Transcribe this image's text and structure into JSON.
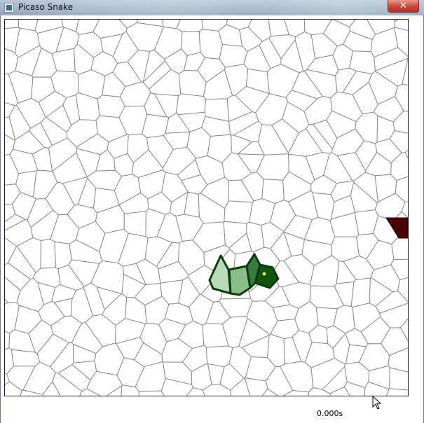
{
  "window": {
    "title": "Picaso Snake",
    "close_glyph": "✕"
  },
  "icons": {
    "app": "app-icon",
    "close": "close-icon",
    "cursor": "mouse-pointer-icon"
  },
  "status": {
    "timer": "0.000s"
  },
  "game": {
    "snake_length": 4,
    "colors": {
      "cell_border": "#8a8a8a",
      "snake_outline": "#0b3d0b",
      "snake_segments": [
        "#bcd9bc",
        "#8bbd8b",
        "#3a7a3a",
        "#0f540f"
      ],
      "head_dot": "#d9e86a",
      "food": "#4a0303"
    }
  }
}
